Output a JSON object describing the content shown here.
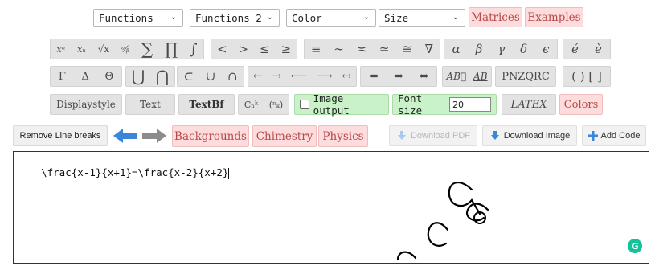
{
  "selects": {
    "functions": "Functions",
    "functions2": "Functions 2",
    "color": "Color",
    "size": "Size"
  },
  "menu": {
    "matrices": "Matrices",
    "examples": "Examples"
  },
  "symbols_row1": {
    "g1": [
      "xⁿ",
      "xₙ",
      "√x",
      "ᵃ⁄ᵦ",
      "∑",
      "∏",
      "∫"
    ],
    "g2": [
      "<",
      ">",
      "≤",
      "≥"
    ],
    "g3": [
      "≡",
      "∼",
      "≍",
      "≃",
      "≅",
      "∇"
    ],
    "g4": [
      "α",
      "β",
      "γ",
      "δ",
      "ϵ"
    ],
    "g5": [
      "é",
      "è"
    ]
  },
  "symbols_row2": {
    "g1": [
      "Γ",
      "Δ",
      "Θ"
    ],
    "g2": [
      "⋃",
      "⋂"
    ],
    "g3": [
      "⊂",
      "∪",
      "∩"
    ],
    "g4": [
      "←",
      "→",
      "⟵",
      "⟶",
      "↔"
    ],
    "g5": [
      "⇐",
      "⇒",
      "⇔"
    ],
    "g6": [
      "AB⃗",
      "AB"
    ],
    "g7": "PNZQRC",
    "g8": "( ) [ ]"
  },
  "row3": {
    "displaystyle": "Displaystyle",
    "text": "Text",
    "textbf": "TextBf",
    "binom1": "Cₙᵏ",
    "binom2": "(ⁿₖ)",
    "image_output": "Image output",
    "font_size_label": "Font size",
    "font_size_value": "20",
    "latex": "LATEX",
    "colors": "Colors"
  },
  "row4": {
    "remove_line_breaks": "Remove Line breaks",
    "backgrounds": "Backgrounds",
    "chimestry": "Chimestry",
    "physics": "Physics",
    "download_pdf": "Download PDF",
    "download_image": "Download Image",
    "add_code": "Add Code"
  },
  "editor": {
    "code": "\\frac{x-1}{x+1}=\\frac{x-2}{x+2}"
  },
  "colors": {
    "accent_pink": "#fcdcdc",
    "accent_green": "#c9f2c9",
    "arrow_blue": "#3a86d8",
    "grammarly_green": "#15c39a"
  }
}
